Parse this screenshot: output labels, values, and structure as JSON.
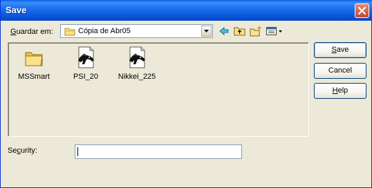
{
  "window": {
    "title": "Save",
    "accent_color": "#0a54d8",
    "close_color": "#c8442a"
  },
  "location": {
    "label_prefix": "G",
    "label_rest": "uardar em:",
    "current_folder": "Cópia de Abr05",
    "icons": [
      "back-arrow-icon",
      "up-folder-icon",
      "new-folder-icon",
      "view-menu-icon"
    ]
  },
  "files": [
    {
      "name": "MSSmart",
      "icon": "folder-icon"
    },
    {
      "name": "PSI_20",
      "icon": "chart-file-icon"
    },
    {
      "name": "Nikkei_225",
      "icon": "chart-file-icon"
    }
  ],
  "buttons": {
    "save_u": "S",
    "save_rest": "ave",
    "cancel": "Cancel",
    "help_u": "H",
    "help_rest": "elp"
  },
  "security": {
    "label_a": "Se",
    "label_u": "c",
    "label_b": "urity:",
    "value": ""
  }
}
